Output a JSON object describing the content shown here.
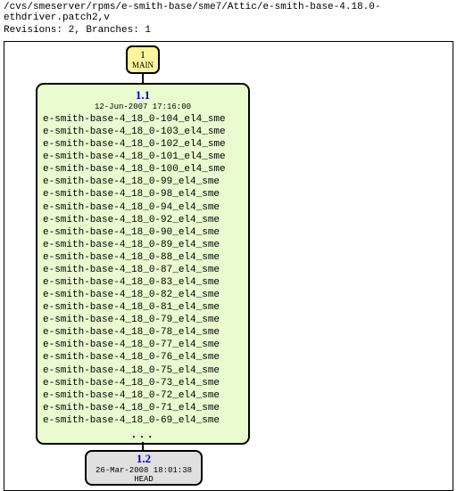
{
  "path": "/cvs/smeserver/rpms/e-smith-base/sme7/Attic/e-smith-base-4.18.0-ethdriver.patch2,v",
  "info": "Revisions: 2, Branches: 1",
  "mainLabel": {
    "num": "1",
    "txt": "MAIN"
  },
  "node1": {
    "rev": "1.1",
    "date": "12-Jun-2007 17:16:00",
    "tags": [
      "e-smith-base-4_18_0-104_el4_sme",
      "e-smith-base-4_18_0-103_el4_sme",
      "e-smith-base-4_18_0-102_el4_sme",
      "e-smith-base-4_18_0-101_el4_sme",
      "e-smith-base-4_18_0-100_el4_sme",
      "e-smith-base-4_18_0-99_el4_sme",
      "e-smith-base-4_18_0-98_el4_sme",
      "e-smith-base-4_18_0-94_el4_sme",
      "e-smith-base-4_18_0-92_el4_sme",
      "e-smith-base-4_18_0-90_el4_sme",
      "e-smith-base-4_18_0-89_el4_sme",
      "e-smith-base-4_18_0-88_el4_sme",
      "e-smith-base-4_18_0-87_el4_sme",
      "e-smith-base-4_18_0-83_el4_sme",
      "e-smith-base-4_18_0-82_el4_sme",
      "e-smith-base-4_18_0-81_el4_sme",
      "e-smith-base-4_18_0-79_el4_sme",
      "e-smith-base-4_18_0-78_el4_sme",
      "e-smith-base-4_18_0-77_el4_sme",
      "e-smith-base-4_18_0-76_el4_sme",
      "e-smith-base-4_18_0-75_el4_sme",
      "e-smith-base-4_18_0-73_el4_sme",
      "e-smith-base-4_18_0-72_el4_sme",
      "e-smith-base-4_18_0-71_el4_sme",
      "e-smith-base-4_18_0-69_el4_sme"
    ],
    "ellipsis": "..."
  },
  "node2": {
    "rev": "1.2",
    "date": "26-Mar-2008 18:01:38",
    "head": "HEAD"
  }
}
